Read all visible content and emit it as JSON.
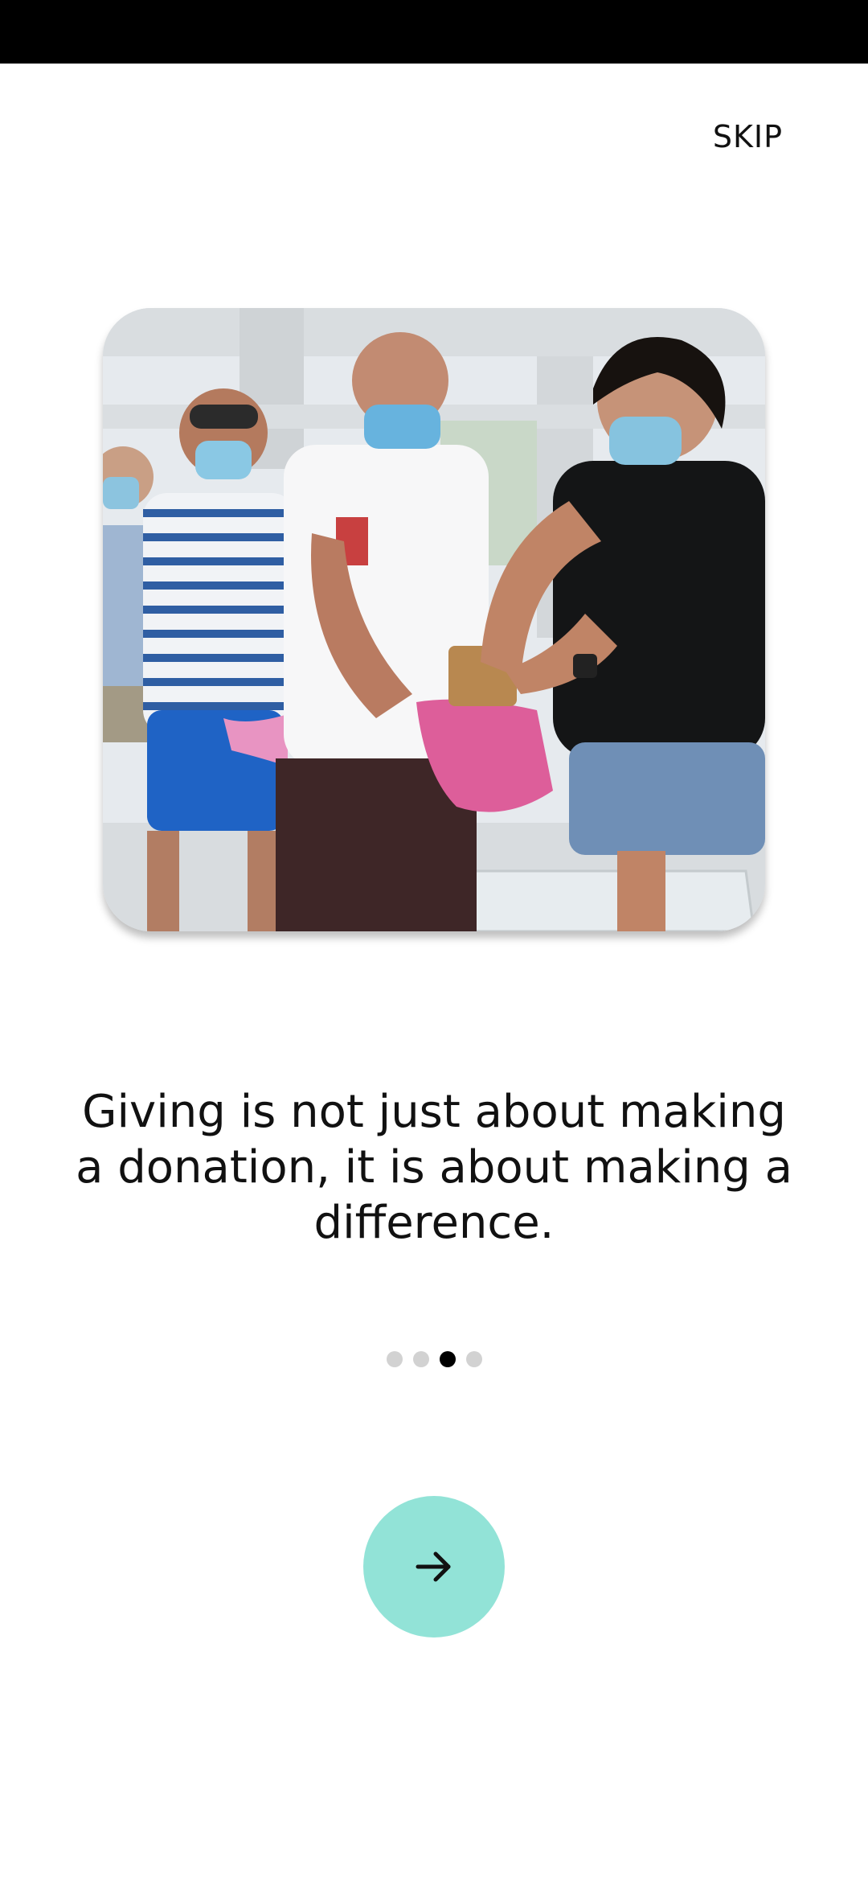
{
  "header": {
    "skip_label": "SKIP"
  },
  "onboarding": {
    "image_icon": "photo-volunteers-food-donation",
    "headline": "Giving is not just about making a donation, it is about making a difference.",
    "page_indicator": {
      "total": 4,
      "current": 3
    }
  },
  "navigation": {
    "next_icon": "arrow-right-icon"
  },
  "colors": {
    "status_bar": "#000000",
    "accent": "#92e3d7",
    "dot_active": "#000000",
    "dot_inactive": "#d2d2d2",
    "text": "#111111"
  }
}
